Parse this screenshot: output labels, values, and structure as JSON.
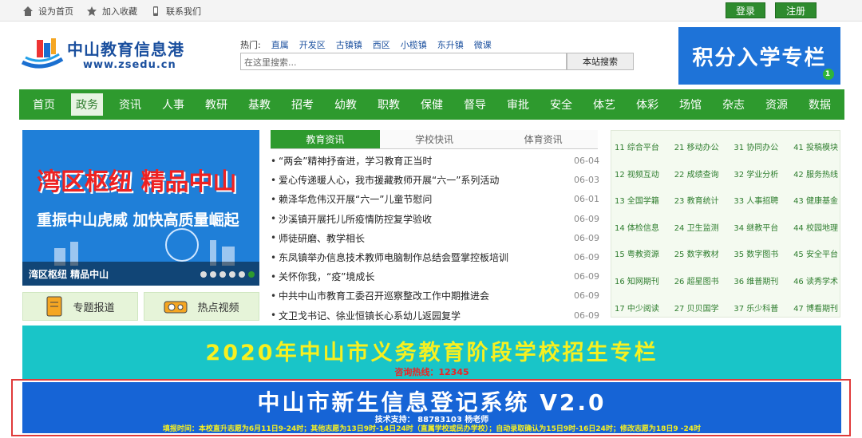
{
  "topbar": {
    "home_label": "设为首页",
    "fav_label": "加入收藏",
    "contact_label": "联系我们",
    "login_label": "登录",
    "register_label": "注册"
  },
  "logo": {
    "name": "中山教育信息港",
    "url": "www.zsedu.cn"
  },
  "search": {
    "hot_label": "热门:",
    "hot_terms": [
      "直属",
      "开发区",
      "古镇镇",
      "西区",
      "小榄镇",
      "东升镇",
      "微课"
    ],
    "placeholder": "在这里搜索...",
    "button_label": "本站搜索"
  },
  "ad_right": {
    "title": "积分入学专栏",
    "badge": "1"
  },
  "nav": [
    "首页",
    "政务",
    "资讯",
    "人事",
    "教研",
    "基教",
    "招考",
    "幼教",
    "职教",
    "保健",
    "督导",
    "审批",
    "安全",
    "体艺",
    "体彩",
    "场馆",
    "杂志",
    "资源",
    "数据"
  ],
  "nav_active": 1,
  "slider": {
    "headline": "湾区枢纽 精品中山",
    "subline": "重振中山虎威 加快高质量崛起",
    "caption": "湾区枢纽 精品中山"
  },
  "quick": {
    "topics_label": "专题报道",
    "video_label": "热点视频"
  },
  "tabs": [
    "教育资讯",
    "学校快讯",
    "体育资讯"
  ],
  "news": [
    {
      "title": "“两会”精神抒奋进，学习教育正当时",
      "date": "06-04"
    },
    {
      "title": "爱心传递暖人心，我市援藏教师开展“六一”系列活动",
      "date": "06-03"
    },
    {
      "title": "赖泽华危伟汉开展“六一”儿童节慰问",
      "date": "06-01"
    },
    {
      "title": "沙溪镇开展托儿所疫情防控复学验收",
      "date": "06-09"
    },
    {
      "title": "师徒研磨、教学相长",
      "date": "06-09"
    },
    {
      "title": "东凤镇举办信息技术教师电脑制作总结会暨掌控板培训",
      "date": "06-09"
    },
    {
      "title": "关怀你我，“疫”境成长",
      "date": "06-09"
    },
    {
      "title": "中共中山市教育工委召开巡察整改工作中期推进会",
      "date": "06-09"
    },
    {
      "title": "文卫戈书记、徐业恒镇长心系幼儿返园复学",
      "date": "06-09"
    }
  ],
  "links": [
    [
      "11 综合平台",
      "21 移动办公",
      "31 协同办公",
      "41 投稿模块"
    ],
    [
      "12 视频互动",
      "22 成绩查询",
      "32 学业分析",
      "42 服务热线"
    ],
    [
      "13 全国学籍",
      "23 教育统计",
      "33 人事招聘",
      "43 健康基金"
    ],
    [
      "14 体检信息",
      "24 卫生监测",
      "34 继教平台",
      "44 校园地理"
    ],
    [
      "15 粤教资源",
      "25 数字教材",
      "35 数字图书",
      "45 安全平台"
    ],
    [
      "16 知网期刊",
      "26 超星图书",
      "36 维普期刊",
      "46 读秀学术"
    ],
    [
      "17 中少阅读",
      "27 贝贝国学",
      "37 乐少科普",
      "47 博看期刊"
    ]
  ],
  "banner_enroll": {
    "title": "2020年中山市义务教育阶段学校招生专栏",
    "hotline": "咨询热线：12345"
  },
  "banner_system": {
    "title": "中山市新生信息登记系统 V2.0",
    "support": "技术支持：  88783103 杨老师",
    "notice": "填报时间：本校直升志愿为6月11日9-24时；其他志愿为13日9时-14日24时（直属学校或民办学校）；自动录取确认为15日9时-16日24时；修改志愿为18日9 -24时"
  },
  "colors": {
    "nav_green": "#2e9a2e",
    "accent_blue": "#1664d6",
    "enroll_teal": "#19c5c8",
    "frame_red": "#e03a3a"
  }
}
